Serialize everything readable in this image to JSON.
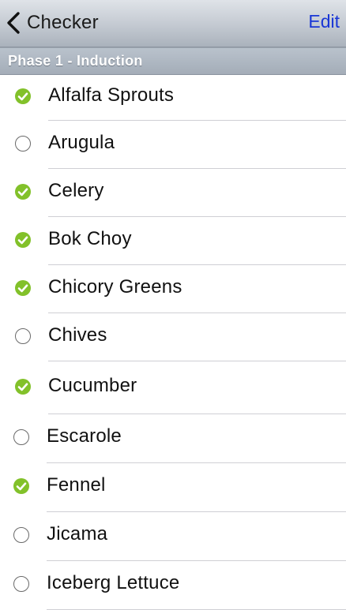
{
  "navbar": {
    "back_label": "Checker",
    "edit_label": "Edit"
  },
  "section": {
    "title": "Phase 1 - Induction"
  },
  "items": [
    {
      "label": "Alfalfa Sprouts",
      "checked": true
    },
    {
      "label": "Arugula",
      "checked": false
    },
    {
      "label": "Celery",
      "checked": true
    },
    {
      "label": "Bok Choy",
      "checked": true
    },
    {
      "label": "Chicory Greens",
      "checked": true
    },
    {
      "label": "Chives",
      "checked": false
    },
    {
      "label": "Cucumber",
      "checked": true
    },
    {
      "label": "Escarole",
      "checked": false
    },
    {
      "label": "Fennel",
      "checked": true
    },
    {
      "label": "Jicama",
      "checked": false
    },
    {
      "label": "Iceberg Lettuce",
      "checked": false
    }
  ],
  "colors": {
    "accent": "#1a37d6",
    "check_green": "#82c12a"
  },
  "icons": {
    "back": "chevron-left-icon",
    "checked": "checkmark-circle-icon",
    "unchecked": "empty-circle-icon"
  }
}
